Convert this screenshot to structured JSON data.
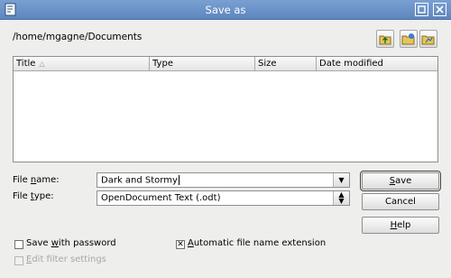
{
  "window": {
    "title": "Save as"
  },
  "path": "/home/mgagne/Documents",
  "columns": [
    "Title",
    "Type",
    "Size",
    "Date modified"
  ],
  "file_name": {
    "label_pre": "File ",
    "label_u": "n",
    "label_post": "ame:",
    "value": "Dark and Stormy"
  },
  "file_type": {
    "label_pre": "File ",
    "label_u": "t",
    "label_post": "ype:",
    "value": "OpenDocument Text (.odt)"
  },
  "buttons": {
    "save": {
      "u": "S",
      "rest": "ave"
    },
    "cancel": "Cancel",
    "help": {
      "u": "H",
      "rest": "elp"
    }
  },
  "options": {
    "save_password": {
      "pre": "Save ",
      "u": "w",
      "post": "ith password",
      "checked": false
    },
    "auto_ext": {
      "pre": "",
      "u": "A",
      "post": "utomatic file name extension",
      "checked": true
    },
    "edit_filter": {
      "pre": "",
      "u": "E",
      "post": "dit filter settings",
      "checked": false,
      "disabled": true
    }
  }
}
